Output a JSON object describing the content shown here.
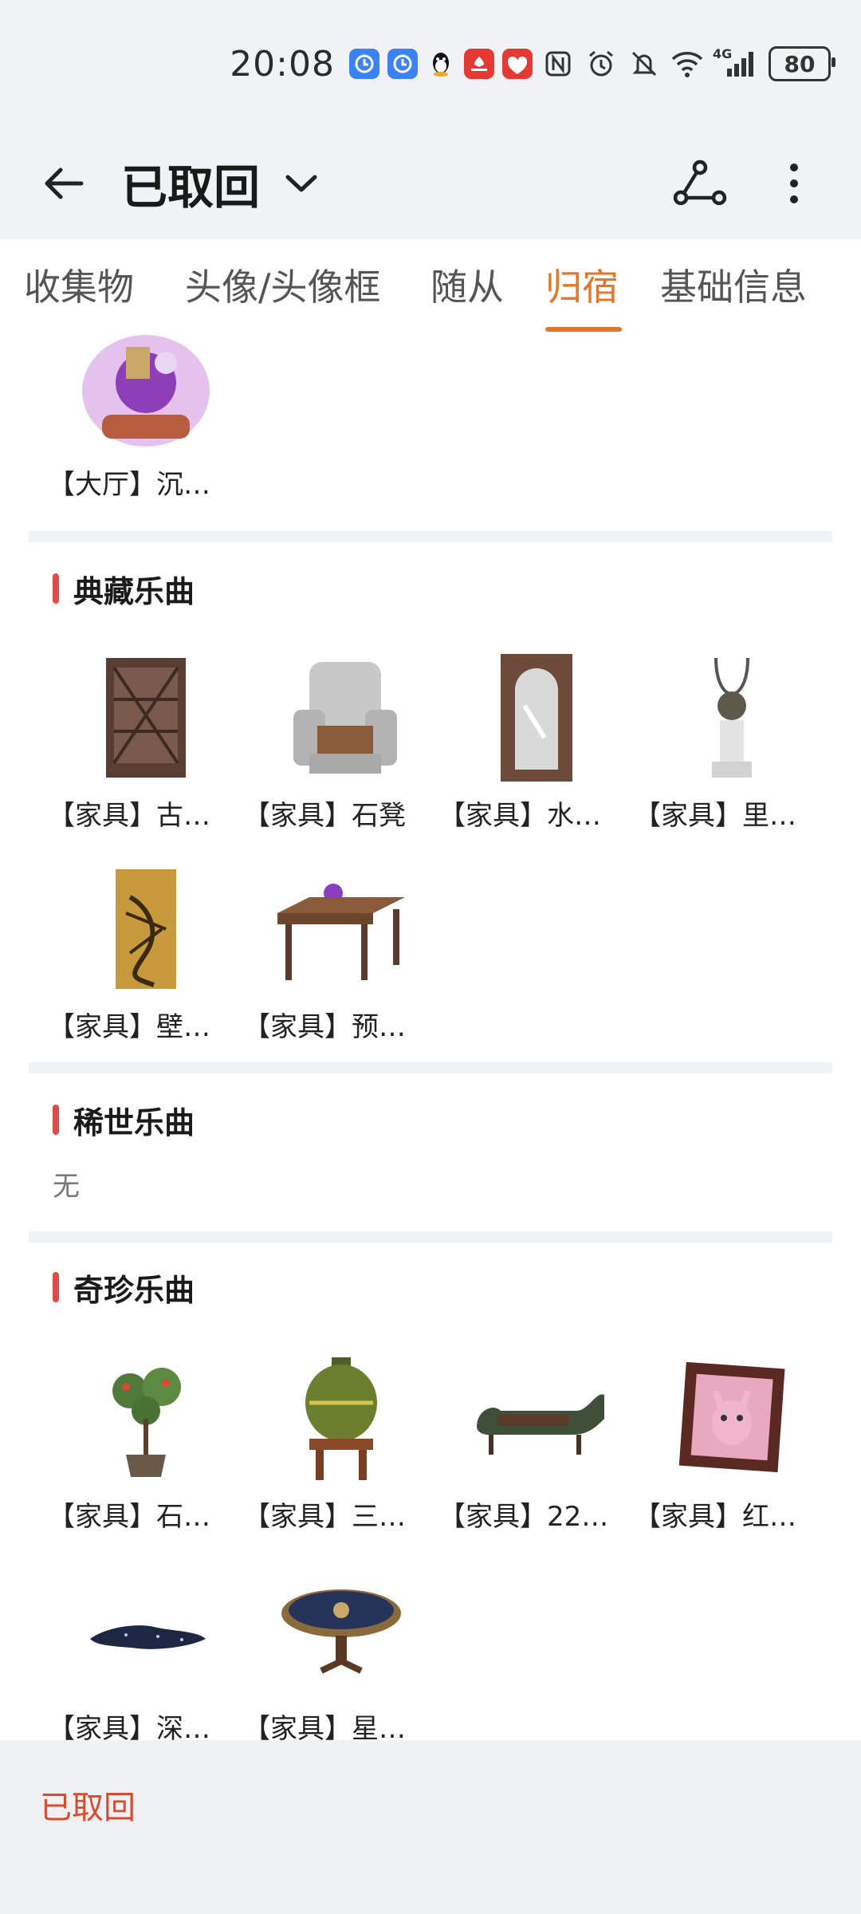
{
  "status_bar": {
    "time": "20:08",
    "network": "4G",
    "battery": "80",
    "icons": [
      "alarm-app-icon",
      "alarm-app-icon",
      "qq-icon",
      "huawei-icon",
      "shopping-618-icon",
      "nfc-icon",
      "alarm-icon",
      "mute-icon",
      "wifi-icon",
      "signal-icon",
      "battery-icon"
    ]
  },
  "header": {
    "title": "已取回",
    "back_icon": "back-arrow-icon",
    "dropdown_icon": "chevron-down-icon",
    "share_icon": "share-icon",
    "more_icon": "more-vertical-icon"
  },
  "tabs": {
    "items": [
      {
        "label": "收集物"
      },
      {
        "label": "头像/头像框"
      },
      {
        "label": "随从"
      },
      {
        "label": "归宿"
      },
      {
        "label": "基础信息"
      }
    ],
    "active": "归宿",
    "active_color": "#e4762b"
  },
  "sections": [
    {
      "title": "",
      "items": [
        {
          "label": "【大厅】沉…"
        }
      ]
    },
    {
      "title": "典藏乐曲",
      "items": [
        {
          "label": "【家具】古…"
        },
        {
          "label": "【家具】石凳"
        },
        {
          "label": "【家具】水…"
        },
        {
          "label": "【家具】里…"
        },
        {
          "label": "【家具】壁…"
        },
        {
          "label": "【家具】预…"
        }
      ]
    },
    {
      "title": "稀世乐曲",
      "empty": "无"
    },
    {
      "title": "奇珍乐曲",
      "items": [
        {
          "label": "【家具】石…"
        },
        {
          "label": "【家具】三…"
        },
        {
          "label": "【家具】22…"
        },
        {
          "label": "【家具】红…"
        },
        {
          "label": "【家具】深…"
        },
        {
          "label": "【家具】星…"
        }
      ]
    }
  ],
  "bottom_bar": {
    "label": "已取回",
    "accent": "#d94a2e"
  },
  "colors": {
    "section_marker": "#e14a4a",
    "background_gray": "#f0f2f5"
  }
}
